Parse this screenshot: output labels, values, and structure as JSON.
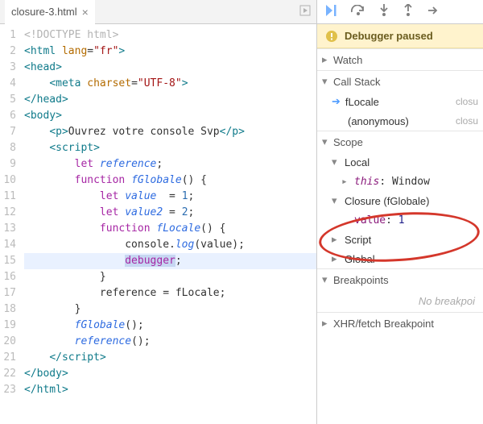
{
  "tab": {
    "name": "closure-3.html"
  },
  "code": {
    "lines": [
      {
        "raw": "<!DOCTYPE html>",
        "type": "comment"
      },
      {
        "tokens": [
          "<",
          "html",
          " ",
          "lang",
          "=",
          "\"fr\"",
          ">"
        ],
        "types": [
          "tag",
          "tag",
          null,
          "attr",
          null,
          "string",
          "tag"
        ]
      },
      {
        "tokens": [
          "<",
          "head",
          ">"
        ],
        "types": [
          "tag",
          "tag",
          "tag"
        ]
      },
      {
        "indent": 1,
        "tokens": [
          "<",
          "meta",
          " ",
          "charset",
          "=",
          "\"UTF-8\"",
          ">"
        ],
        "types": [
          "tag",
          "tag",
          null,
          "attr",
          null,
          "string",
          "tag"
        ]
      },
      {
        "tokens": [
          "</",
          "head",
          ">"
        ],
        "types": [
          "tag",
          "tag",
          "tag"
        ]
      },
      {
        "tokens": [
          "<",
          "body",
          ">"
        ],
        "types": [
          "tag",
          "tag",
          "tag"
        ]
      },
      {
        "indent": 1,
        "tokens": [
          "<",
          "p",
          ">",
          "Ouvrez votre console Svp",
          "</",
          "p",
          ">"
        ],
        "types": [
          "tag",
          "tag",
          "tag",
          null,
          "tag",
          "tag",
          "tag"
        ]
      },
      {
        "indent": 1,
        "tokens": [
          "<",
          "script",
          ">"
        ],
        "types": [
          "tag",
          "tag",
          "tag"
        ]
      },
      {
        "indent": 2,
        "tokens": [
          "let",
          " ",
          "reference",
          ";"
        ],
        "types": [
          "keyword",
          null,
          "def",
          null
        ]
      },
      {
        "indent": 2,
        "tokens": [
          "function",
          " ",
          "fGlobale",
          "() {"
        ],
        "types": [
          "keyword",
          null,
          "func",
          null
        ]
      },
      {
        "indent": 3,
        "tokens": [
          "let",
          " ",
          "value",
          "  = ",
          "1",
          ";"
        ],
        "types": [
          "keyword",
          null,
          "def",
          null,
          "num",
          null
        ]
      },
      {
        "indent": 3,
        "tokens": [
          "let",
          " ",
          "value2",
          " = ",
          "2",
          ";"
        ],
        "types": [
          "keyword",
          null,
          "def",
          null,
          "num",
          null
        ]
      },
      {
        "indent": 3,
        "tokens": [
          "function",
          " ",
          "fLocale",
          "() {"
        ],
        "types": [
          "keyword",
          null,
          "func",
          null
        ]
      },
      {
        "indent": 4,
        "tokens": [
          "console.",
          "log",
          "(value);"
        ],
        "types": [
          null,
          "func",
          null
        ]
      },
      {
        "indent": 4,
        "highlight": true,
        "tokens": [
          "debugger",
          ";"
        ],
        "types": [
          "keyword",
          null
        ]
      },
      {
        "indent": 3,
        "tokens": [
          "}"
        ],
        "types": [
          null
        ]
      },
      {
        "indent": 3,
        "tokens": [
          "reference = fLocale;"
        ],
        "types": [
          null
        ]
      },
      {
        "indent": 2,
        "tokens": [
          "}"
        ],
        "types": [
          null
        ]
      },
      {
        "indent": 2,
        "tokens": [
          "fGlobale",
          "();"
        ],
        "types": [
          "func",
          null
        ]
      },
      {
        "indent": 2,
        "tokens": [
          "reference",
          "();"
        ],
        "types": [
          "func",
          null
        ]
      },
      {
        "indent": 1,
        "tokens": [
          "</",
          "script",
          ">"
        ],
        "types": [
          "tag",
          "tag",
          "tag"
        ]
      },
      {
        "tokens": [
          "</",
          "body",
          ">"
        ],
        "types": [
          "tag",
          "tag",
          "tag"
        ]
      },
      {
        "tokens": [
          "</",
          "html",
          ">"
        ],
        "types": [
          "tag",
          "tag",
          "tag"
        ]
      }
    ]
  },
  "debugger": {
    "paused_label": "Debugger paused",
    "sections": {
      "watch": "Watch",
      "callstack": "Call Stack",
      "scope": "Scope",
      "breakpoints": "Breakpoints",
      "xhr": "XHR/fetch Breakpoint"
    },
    "callstack": [
      {
        "name": "fLocale",
        "source": "closu",
        "current": true
      },
      {
        "name": "(anonymous)",
        "source": "closu",
        "current": false
      }
    ],
    "scope": {
      "local": {
        "label": "Local",
        "this_label": "this",
        "this_val": "Window"
      },
      "closure": {
        "label": "Closure (fGlobale)",
        "prop_name": "value",
        "prop_val": "1"
      },
      "script": "Script",
      "global": "Global"
    },
    "no_breakpoints": "No breakpoi"
  }
}
